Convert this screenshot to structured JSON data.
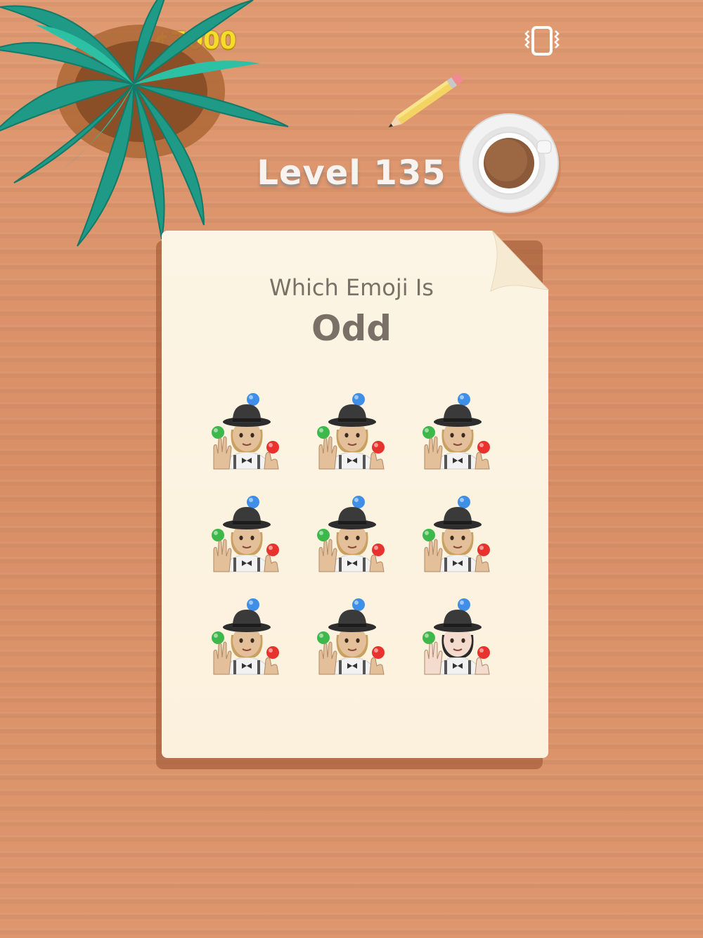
{
  "header": {
    "coins": "¢7000",
    "vibrate_icon": "vibration-phone-icon"
  },
  "level_title": "Level 135",
  "question": {
    "line1": "Which Emoji Is",
    "line2": "Odd"
  },
  "emoji_grid": {
    "rows": 3,
    "cols": 3,
    "emoji": "person-juggling",
    "cells": [
      {
        "tone": "#e3bf9a",
        "hair": "#c9a060"
      },
      {
        "tone": "#e3bf9a",
        "hair": "#c9a060"
      },
      {
        "tone": "#e3bf9a",
        "hair": "#c9a060"
      },
      {
        "tone": "#e3bf9a",
        "hair": "#c9a060"
      },
      {
        "tone": "#e3bf9a",
        "hair": "#c9a060"
      },
      {
        "tone": "#e3bf9a",
        "hair": "#c9a060"
      },
      {
        "tone": "#e3bf9a",
        "hair": "#c9a060"
      },
      {
        "tone": "#e3bf9a",
        "hair": "#c9a060"
      },
      {
        "tone": "#f3dccd",
        "hair": "#2b2b2b"
      }
    ]
  },
  "colors": {
    "table": "#d98f66",
    "paper": "#fcf4e4",
    "text": "#7b7068",
    "coins": "#f5dc2a",
    "ball_blue": "#3f8fe8",
    "ball_green": "#3db84a",
    "ball_red": "#e8322e"
  }
}
